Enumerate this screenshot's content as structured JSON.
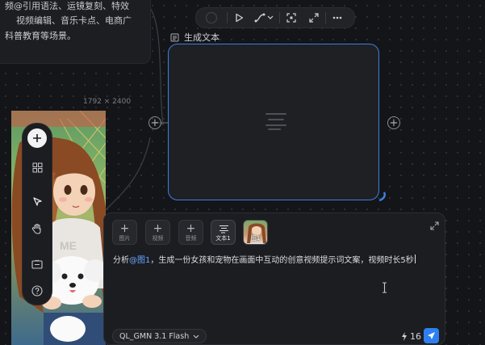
{
  "description_card": {
    "lines": [
      "频@引用语法、运镜复刻、特效",
      "视频编辑、音乐卡点、电商广",
      "科普教育等场景。"
    ]
  },
  "node": {
    "title": "生成文本",
    "icon": "text-doc-icon",
    "accent": "#3e7ee0"
  },
  "image_node": {
    "dimensions": "1792 × 2400"
  },
  "prompt_panel": {
    "attachments": [
      {
        "label": "图片",
        "icon": "plus-icon"
      },
      {
        "label": "视频",
        "icon": "plus-icon"
      },
      {
        "label": "音频",
        "icon": "plus-icon"
      }
    ],
    "references": [
      {
        "label": "文本1",
        "icon": "text-lines-icon"
      },
      {
        "label": "图1",
        "icon": "image-thumbnail"
      }
    ],
    "prompt": {
      "before": "分析",
      "mention": "@图1",
      "after": "，生成一份女孩和宠物在画面中互动的创意视频提示词文案，视频时长5秒"
    },
    "model": "QL_GMN 3.1 Flash",
    "credits": "16",
    "send_color": "#2e7ff0"
  },
  "toolbar_icons": [
    "record-icon",
    "play-icon",
    "connector-icon",
    "fit-view-icon",
    "fullscreen-icon",
    "more-icon"
  ],
  "side_toolbar_icons": [
    "add-icon",
    "grid-icon",
    "pointer-icon",
    "hand-icon",
    "screen-icon",
    "help-icon"
  ]
}
